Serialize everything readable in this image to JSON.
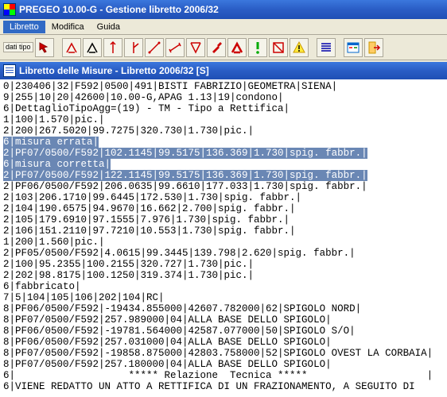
{
  "window": {
    "title": "PREGEO 10.00-G - Gestione libretto 2006/32"
  },
  "menu": {
    "items": [
      "Libretto",
      "Modifica",
      "Guida"
    ],
    "active_index": 0
  },
  "toolbar": {
    "dati_tipo": "dati\ntipo"
  },
  "child_window": {
    "title": "Libretto delle Misure - Libretto 2006/32 [S]"
  },
  "lines": [
    {
      "t": "0|230406|32|F592|0500|491|BISTI FABRIZIO|GEOMETRA|SIENA|",
      "sel": false
    },
    {
      "t": "9|255|10|20|42600|10.00-G,APAG 1.13|19|condono|",
      "sel": false
    },
    {
      "t": "6|DettaglioTipoAgg=(19) - TM - Tipo a Rettifica|",
      "sel": false
    },
    {
      "t": "1|100|1.570|pic.|",
      "sel": false
    },
    {
      "t": "2|200|267.5020|99.7275|320.730|1.730|pic.|",
      "sel": false
    },
    {
      "t": "6|misura errata|",
      "sel": true
    },
    {
      "t": "2|PF07/0500/F592|102.1145|99.5175|136.369|1.730|spig. fabbr.|",
      "sel": true
    },
    {
      "t": "6|misura corretta|",
      "sel": true
    },
    {
      "t": "2|PF07/0500/F592|122.1145|99.5175|136.369|1.730|spig. fabbr.|",
      "sel": true
    },
    {
      "t": "2|PF06/0500/F592|206.0635|99.6610|177.033|1.730|spig. fabbr.|",
      "sel": false
    },
    {
      "t": "2|103|206.1710|99.6445|172.530|1.730|spig. fabbr.|",
      "sel": false
    },
    {
      "t": "2|104|190.6575|94.9670|16.662|2.700|spig. fabbr.|",
      "sel": false
    },
    {
      "t": "2|105|179.6910|97.1555|7.976|1.730|spig. fabbr.|",
      "sel": false
    },
    {
      "t": "2|106|151.2110|97.7210|10.553|1.730|spig. fabbr.|",
      "sel": false
    },
    {
      "t": "1|200|1.560|pic.|",
      "sel": false
    },
    {
      "t": "2|PF05/0500/F592|4.0615|99.3445|139.798|2.620|spig. fabbr.|",
      "sel": false
    },
    {
      "t": "2|100|95.2355|100.2155|320.727|1.730|pic.|",
      "sel": false
    },
    {
      "t": "2|202|98.8175|100.1250|319.374|1.730|pic.|",
      "sel": false
    },
    {
      "t": "6|fabbricato|",
      "sel": false
    },
    {
      "t": "7|5|104|105|106|202|104|RC|",
      "sel": false
    },
    {
      "t": "8|PF06/0500/F592|-19434.855000|42607.782000|62|SPIGOLO NORD|",
      "sel": false
    },
    {
      "t": "8|PF07/0500/F592|257.989000|04|ALLA BASE DELLO SPIGOLO|",
      "sel": false
    },
    {
      "t": "8|PF06/0500/F592|-19781.564000|42587.077000|50|SPIGOLO S/O|",
      "sel": false
    },
    {
      "t": "8|PF06/0500/F592|257.031000|04|ALLA BASE DELLO SPIGOLO|",
      "sel": false
    },
    {
      "t": "8|PF07/0500/F592|-19858.875000|42803.758000|52|SPIGOLO OVEST LA CORBAIA|",
      "sel": false
    },
    {
      "t": "8|PF07/0500/F592|257.180000|04|ALLA BASE DELLO SPIGOLO|",
      "sel": false
    },
    {
      "t": "6|                   ***** Relazione  Tecnica *****                    |",
      "sel": false
    },
    {
      "t": "6|VIENE REDATTO UN ATTO A RETTIFICA DI UN FRAZIONAMENTO, A SEGUITO DI",
      "sel": false
    }
  ]
}
